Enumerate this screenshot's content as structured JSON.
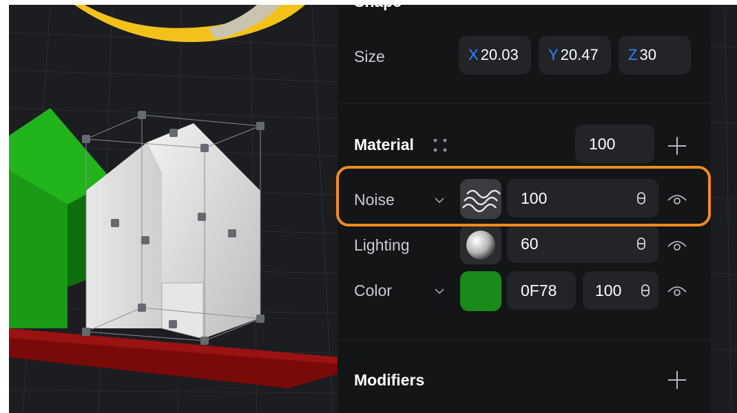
{
  "shape": {
    "title": "Shape",
    "size_label": "Size",
    "x_axis": "X",
    "x_value": "20.03",
    "y_axis": "Y",
    "y_value": "20.47",
    "z_axis": "Z",
    "z_value": "30"
  },
  "material": {
    "title": "Material",
    "opacity_value": "100",
    "layers": [
      {
        "name": "Noise",
        "value": "100",
        "icon": "noise-wave-icon"
      },
      {
        "name": "Lighting",
        "value": "60",
        "icon": "sphere-icon"
      },
      {
        "name": "Color",
        "hex": "0F78",
        "value": "100",
        "swatch_color": "#1a8a1a"
      }
    ]
  },
  "modifiers": {
    "title": "Modifiers"
  },
  "colors": {
    "panel_bg": "#141517",
    "field_bg": "#232428",
    "axis_blue": "#2f86ff",
    "highlight_orange": "#f28c1e",
    "house_green": "#1a9a16",
    "floor_red": "#7a0a0a"
  }
}
